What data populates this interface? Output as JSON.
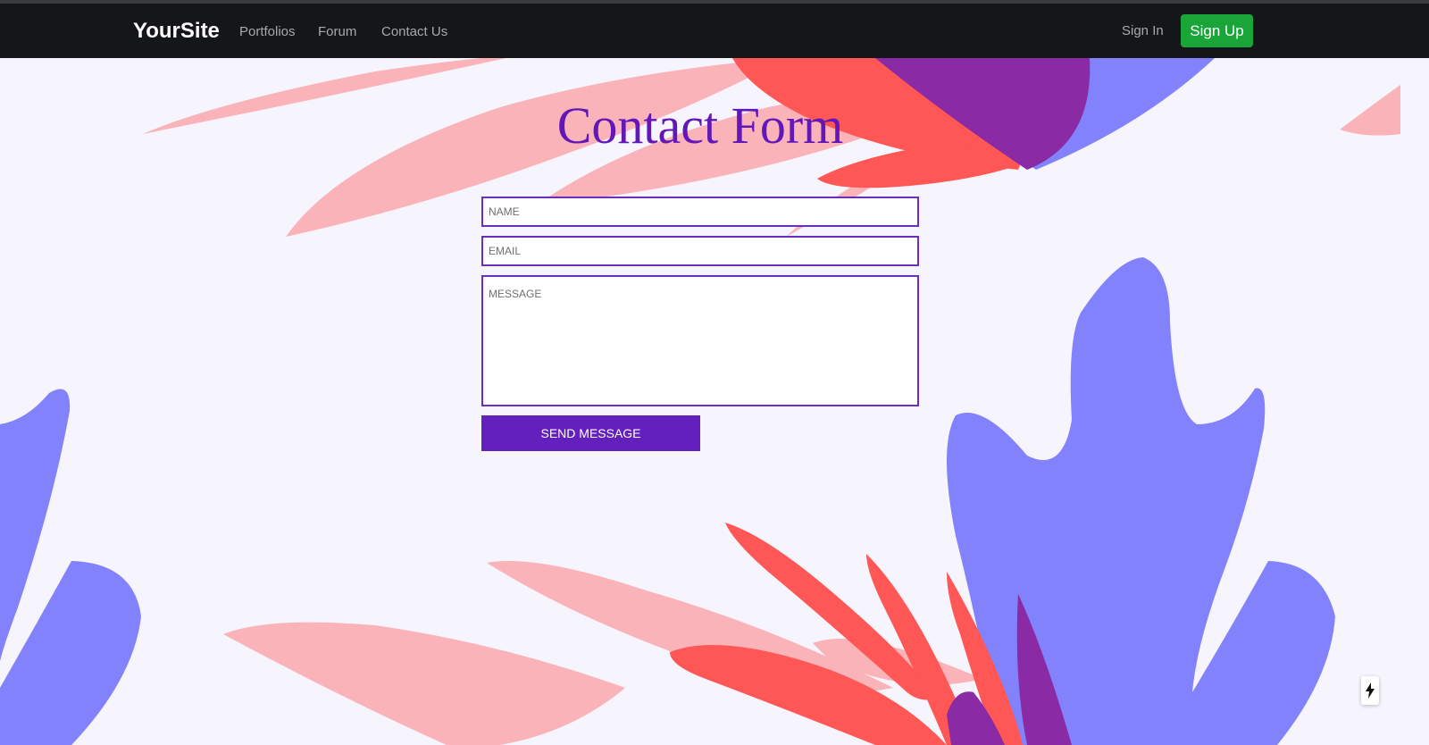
{
  "navbar": {
    "brand": "YourSite",
    "links": [
      {
        "label": "Portfolios"
      },
      {
        "label": "Forum"
      },
      {
        "label": "Contact Us"
      }
    ],
    "sign_in": "Sign In",
    "sign_up": "Sign Up"
  },
  "form": {
    "title": "Contact Form",
    "name_placeholder": "NAME",
    "email_placeholder": "EMAIL",
    "message_placeholder": "MESSAGE",
    "name_value": "",
    "email_value": "",
    "message_value": "",
    "submit_label": "SEND MESSAGE"
  },
  "colors": {
    "navbar_bg": "#151619",
    "accent_purple": "#6420bd",
    "signup_green": "#1aa539",
    "page_bg": "#f6f4fd",
    "leaf_pink": "#fab3b8",
    "leaf_red": "#ff5755",
    "leaf_blue": "#8282fd",
    "leaf_violet": "#8a2aa5"
  },
  "icons": {
    "corner_widget": "lightning-bolt-icon"
  }
}
